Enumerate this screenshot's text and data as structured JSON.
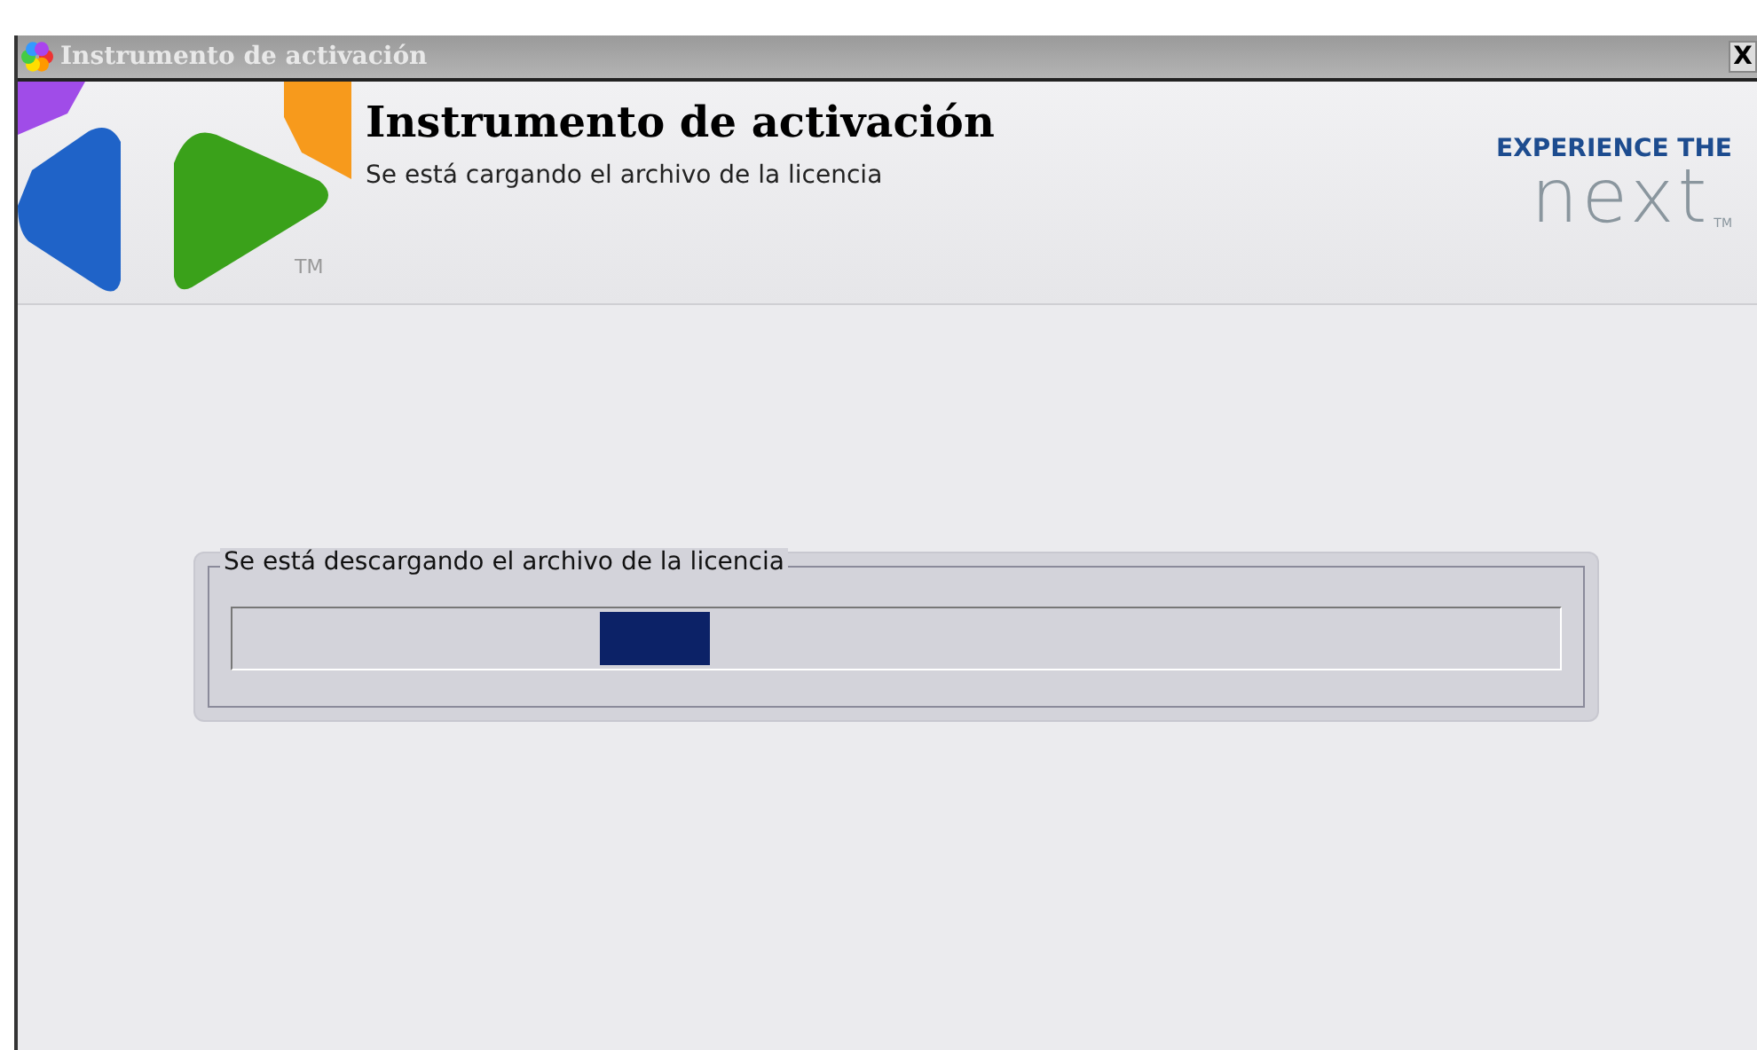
{
  "window": {
    "title": "Instrumento de activación",
    "close": "X"
  },
  "header": {
    "title": "Instrumento de activación",
    "subtitle": "Se está cargando el archivo de la licencia",
    "logo_mark": "TM",
    "brand": {
      "tagline": "EXPERIENCE THE",
      "wordmark": "next",
      "mark": "TM"
    }
  },
  "progress_group": {
    "label": "Se está descargando el archivo de la licencia",
    "indeterminate": true
  }
}
